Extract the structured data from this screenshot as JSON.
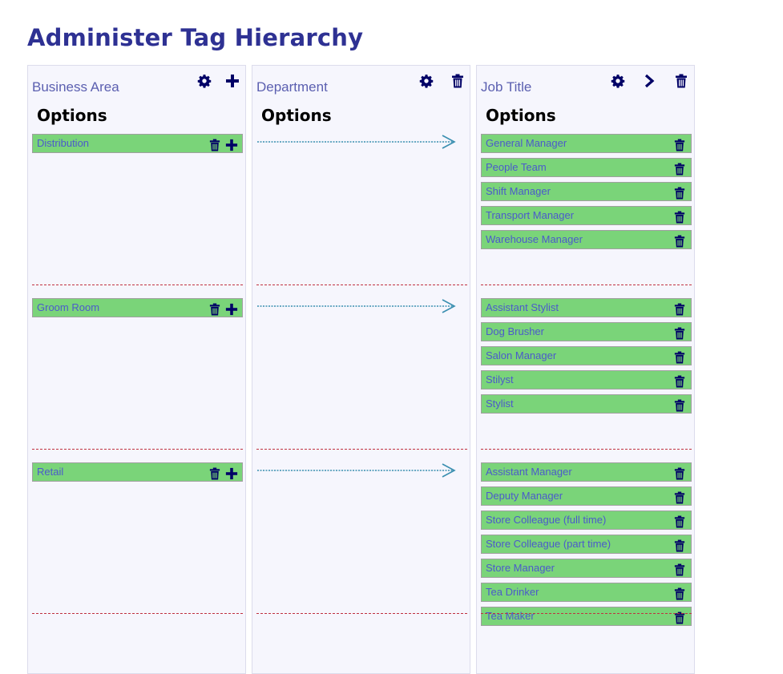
{
  "page": {
    "title": "Administer Tag Hierarchy"
  },
  "columns": [
    {
      "title": "Business Area",
      "options_label": "Options",
      "header_icons": [
        "gear-icon",
        "plus-icon"
      ]
    },
    {
      "title": "Department",
      "options_label": "Options",
      "header_icons": [
        "gear-icon",
        "trash-icon"
      ]
    },
    {
      "title": "Job Title",
      "options_label": "Options",
      "header_icons": [
        "gear-icon",
        "chevron-right-icon",
        "trash-icon"
      ]
    }
  ],
  "groups": [
    {
      "business_area": "Distribution",
      "job_titles": [
        "General Manager",
        "People Team",
        "Shift Manager",
        "Transport Manager",
        "Warehouse Manager"
      ]
    },
    {
      "business_area": "Groom Room",
      "job_titles": [
        "Assistant Stylist",
        "Dog Brusher",
        "Salon Manager",
        "Stilyst",
        "Stylist"
      ]
    },
    {
      "business_area": "Retail",
      "job_titles": [
        "Assistant Manager",
        "Deputy Manager",
        "Store Colleague (full time)",
        "Store Colleague (part time)",
        "Store Manager",
        "Tea Drinker",
        "Tea Maker"
      ]
    }
  ],
  "icons": {
    "tag_business_area": [
      "trash-icon",
      "plus-icon"
    ],
    "tag_job_title": [
      "trash-icon"
    ],
    "department_connector": "arrow-right-icon"
  },
  "colors": {
    "title": "#2e3193",
    "icon": "#000066",
    "tag_background": "#7ad479",
    "tag_text": "#4b5acb",
    "column_title": "#5b5fb0",
    "column_background": "#f6f6fd",
    "divider": "#c03040",
    "arrow": "#3a8fb0"
  }
}
